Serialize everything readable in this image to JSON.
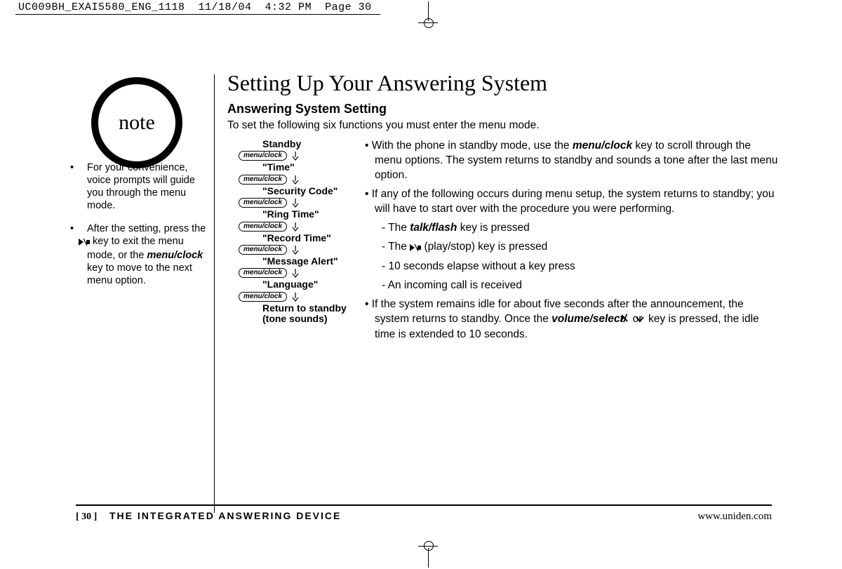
{
  "header": {
    "text": "UC009BH_EXAI5580_ENG_1118  11/18/04  4:32 PM  Page 30"
  },
  "note": {
    "label": "note",
    "items": [
      "For your convenience, voice prompts will guide you through the menu mode.",
      "After the setting, press the  ▶/■  key to exit the menu mode, or the menu/clock key to move to the next menu option."
    ],
    "item2_prefix": "After the setting, press the ",
    "item2_mid1": " key to exit the menu mode, or the ",
    "item2_bold": "menu/clock",
    "item2_suffix": " key to move to the next menu option."
  },
  "content": {
    "title": "Setting Up Your Answering System",
    "subtitle": "Answering System Setting",
    "intro": "To set the following six functions you must enter the menu mode."
  },
  "menu_flow": {
    "pill": "menu/clock",
    "labels": [
      "Standby",
      "\"Time\"",
      "\"Security Code\"",
      "\"Ring Time\"",
      "\"Record Time\"",
      "\"Message Alert\"",
      "\"Language\"",
      "Return to standby (tone sounds)"
    ]
  },
  "bullets": {
    "b1_prefix": "With the phone in standby mode, use the ",
    "b1_bold": "menu/clock",
    "b1_suffix": " key to scroll through the menu options. The system returns to standby and sounds a tone after the last menu option.",
    "b2": "If any of the following occurs during menu setup, the system returns to standby; you will have to start over with the procedure you were performing.",
    "b2s1_prefix": "- The ",
    "b2s1_bold": "talk/flash",
    "b2s1_suffix": " key is pressed",
    "b2s2_prefix": "- The ",
    "b2s2_suffix": " (play/stop) key is pressed",
    "b2s3": "- 10 seconds elapse without a key press",
    "b2s4": "- An incoming call is received",
    "b3_prefix": "If the system remains idle for about five seconds after the announcement, the system returns to standby. Once the ",
    "b3_bold": "volume/select/",
    "b3_mid": " or ",
    "b3_suffix": " key is pressed, the idle time is extended to 10 seconds."
  },
  "footer": {
    "page": "[ 30 ]",
    "section": "THE INTEGRATED ANSWERING DEVICE",
    "url": "www.uniden.com"
  }
}
